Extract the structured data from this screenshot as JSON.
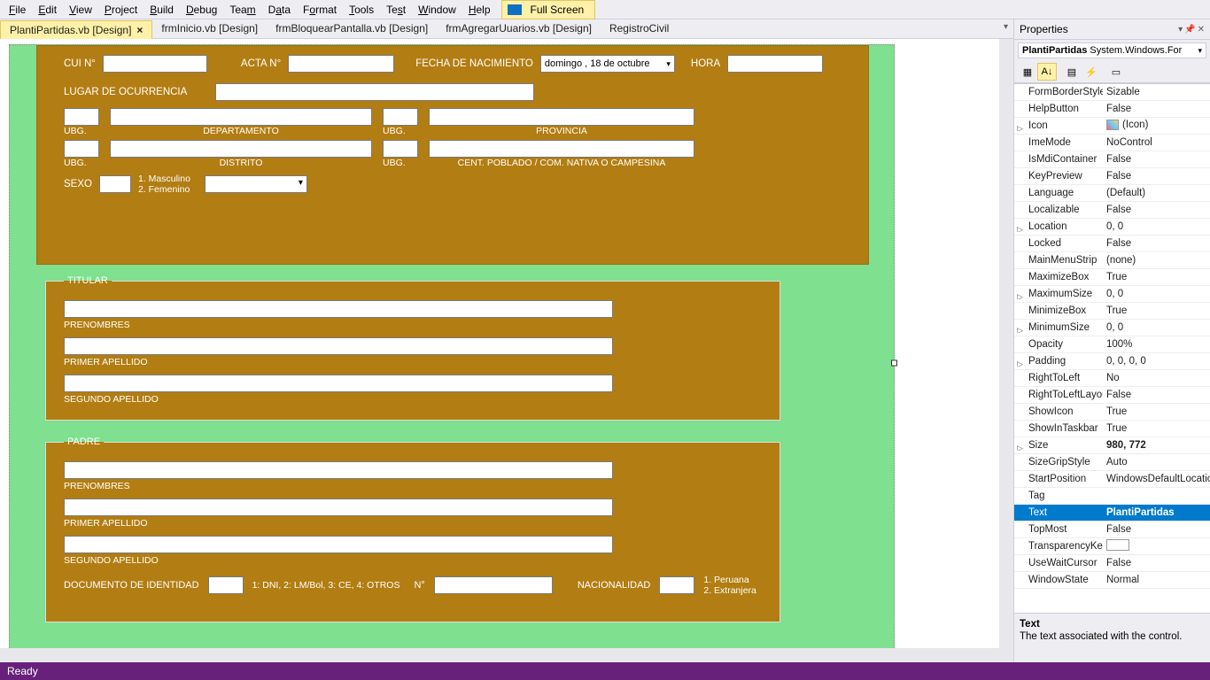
{
  "menu": [
    "File",
    "Edit",
    "View",
    "Project",
    "Build",
    "Debug",
    "Team",
    "Data",
    "Format",
    "Tools",
    "Test",
    "Window",
    "Help"
  ],
  "fullscreen": "Full Screen",
  "tabs": [
    {
      "label": "PlantiPartidas.vb [Design]",
      "active": true
    },
    {
      "label": "frmInicio.vb [Design]"
    },
    {
      "label": "frmBloquearPantalla.vb [Design]"
    },
    {
      "label": "frmAgregarUuarios.vb [Design]"
    },
    {
      "label": "RegistroCivil"
    }
  ],
  "form": {
    "cui": "CUI N°",
    "acta": "ACTA N°",
    "fechanac": "FECHA DE NACIMIENTO",
    "fecha_value": "domingo , 18 de   octubre",
    "hora": "HORA",
    "lugar": "LUGAR DE OCURRENCIA",
    "ubg": "UBG.",
    "departamento": "DEPARTAMENTO",
    "provincia": "PROVINCIA",
    "distrito": "DISTRITO",
    "centpob": "CENT. POBLADO / COM. NATIVA O CAMPESINA",
    "sexo": "SEXO",
    "sexo1": "1. Masculino",
    "sexo2": "2. Femenino",
    "titular": "TITULAR",
    "padre": "PADRE",
    "prenombres": "PRENOMBRES",
    "primerap": "PRIMER APELLIDO",
    "segundoap": "SEGUNDO APELLIDO",
    "docid": "DOCUMENTO DE IDENTIDAD",
    "doctipos": "1: DNI, 2: LM/Bol, 3: CE, 4: OTROS",
    "numero": "N°",
    "nacionalidad": "NACIONALIDAD",
    "nac1": "1. Peruana",
    "nac2": "2. Extranjera"
  },
  "properties": {
    "title": "Properties",
    "object": "PlantiPartidas",
    "objectType": "System.Windows.For",
    "rows": [
      {
        "name": "FormBorderStyle",
        "value": "Sizable"
      },
      {
        "name": "HelpButton",
        "value": "False"
      },
      {
        "name": "Icon",
        "value": "(Icon)",
        "exp": true,
        "icon": true
      },
      {
        "name": "ImeMode",
        "value": "NoControl"
      },
      {
        "name": "IsMdiContainer",
        "value": "False"
      },
      {
        "name": "KeyPreview",
        "value": "False"
      },
      {
        "name": "Language",
        "value": "(Default)"
      },
      {
        "name": "Localizable",
        "value": "False"
      },
      {
        "name": "Location",
        "value": "0, 0",
        "exp": true
      },
      {
        "name": "Locked",
        "value": "False"
      },
      {
        "name": "MainMenuStrip",
        "value": "(none)"
      },
      {
        "name": "MaximizeBox",
        "value": "True"
      },
      {
        "name": "MaximumSize",
        "value": "0, 0",
        "exp": true
      },
      {
        "name": "MinimizeBox",
        "value": "True"
      },
      {
        "name": "MinimumSize",
        "value": "0, 0",
        "exp": true
      },
      {
        "name": "Opacity",
        "value": "100%"
      },
      {
        "name": "Padding",
        "value": "0, 0, 0, 0",
        "exp": true
      },
      {
        "name": "RightToLeft",
        "value": "No"
      },
      {
        "name": "RightToLeftLayout",
        "value": "False"
      },
      {
        "name": "ShowIcon",
        "value": "True"
      },
      {
        "name": "ShowInTaskbar",
        "value": "True"
      },
      {
        "name": "Size",
        "value": "980, 772",
        "exp": true,
        "bold": true
      },
      {
        "name": "SizeGripStyle",
        "value": "Auto"
      },
      {
        "name": "StartPosition",
        "value": "WindowsDefaultLocation"
      },
      {
        "name": "Tag",
        "value": ""
      },
      {
        "name": "Text",
        "value": "PlantiPartidas",
        "selected": true,
        "bold": true
      },
      {
        "name": "TopMost",
        "value": "False"
      },
      {
        "name": "TransparencyKey",
        "value": "",
        "swatch": true
      },
      {
        "name": "UseWaitCursor",
        "value": "False"
      },
      {
        "name": "WindowState",
        "value": "Normal"
      }
    ],
    "desc_title": "Text",
    "desc_body": "The text associated with the control."
  },
  "status": "Ready"
}
